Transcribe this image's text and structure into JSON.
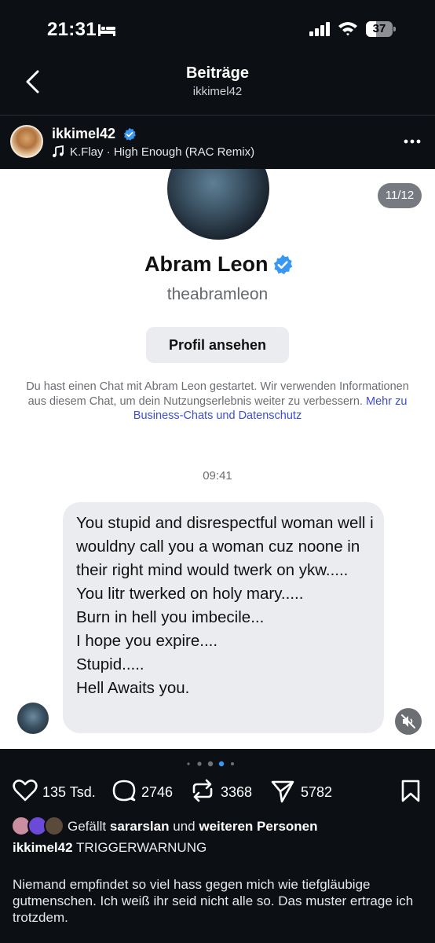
{
  "status_bar": {
    "time": "21:31",
    "battery": "37",
    "icons": [
      "bed-icon",
      "signal-icon",
      "wifi-icon",
      "battery-icon"
    ]
  },
  "header": {
    "title": "Beiträge",
    "subtitle": "ikkimel42"
  },
  "post": {
    "username": "ikkimel42",
    "music": "K.Flay · High Enough (RAC Remix)",
    "counter": "11/12"
  },
  "screenshot": {
    "profile_name": "Abram Leon",
    "profile_handle": "theabramleon",
    "profile_button": "Profil ansehen",
    "info_text": "Du hast einen Chat mit Abram Leon gestartet. Wir verwenden Informationen aus diesem Chat, um dein Nutzungserlebnis weiter zu verbessern.",
    "info_link": "Mehr zu Business-Chats und Datenschutz",
    "message_time": "09:41",
    "message": "You stupid and disrespectful woman well i wouldny call you a woman cuz noone in their right mind would twerk on ykw.....\nYou litr twerked on holy mary.....\nBurn in hell you imbecile...\nI hope you expire....\nStupid.....\nHell Awaits you."
  },
  "carousel": {
    "total": 5,
    "active_index": 3
  },
  "actions": {
    "likes": "135 Tsd.",
    "comments": "2746",
    "reposts": "3368",
    "shares": "5782"
  },
  "liked_by": {
    "prefix": "Gefällt",
    "user": "sararslan",
    "connector": "und",
    "others": "weiteren Personen"
  },
  "caption": {
    "username": "ikkimel42",
    "text": "TRIGGERWARNUNG",
    "body": "Niemand empfindet so viel hass gegen mich wie tiefgläubige gutmenschen. Ich weiß ihr seid nicht alle so. Das muster ertrage ich trotzdem."
  },
  "colors": {
    "background": "#0c0f14",
    "verified": "#3897f0",
    "link": "#3b4fd6",
    "active_dot": "#3897f0"
  }
}
